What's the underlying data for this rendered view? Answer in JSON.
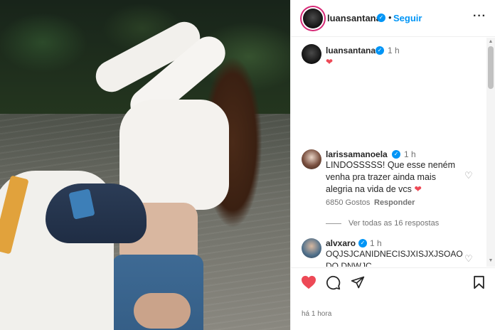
{
  "post": {
    "author": "luansantana",
    "follow_label": "Seguir",
    "separator": "•",
    "more_label": "···",
    "caption_time": "1 h",
    "caption_emoji": "❤",
    "posted_ago": "há 1 hora"
  },
  "comments": [
    {
      "user": "larissamanoela",
      "time": "1 h",
      "text": "LINDOSSSSS! Que esse neném venha pra trazer ainda mais alegria na vida de vcs",
      "emoji": "❤",
      "likes": "6850 Gostos",
      "reply_label": "Responder",
      "view_replies": "Ver todas as 16 respostas"
    },
    {
      "user": "alvxaro",
      "time": "1 h",
      "text": "OQJSJCANIDNECISJXISJXJSOAODO DNWJC"
    }
  ],
  "icons": {
    "verified": "✓",
    "like_outline": "♡",
    "scroll_up": "▲",
    "scroll_down": "▼"
  },
  "colors": {
    "link_blue": "#0095f6",
    "heart_red": "#ed4956",
    "story_ring": "#d62976"
  }
}
